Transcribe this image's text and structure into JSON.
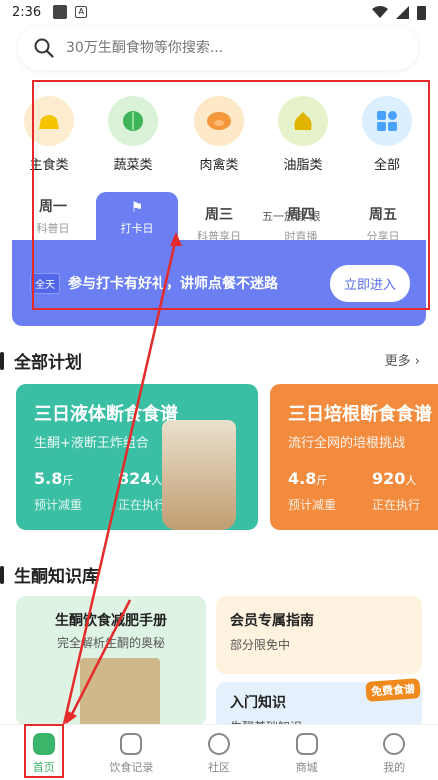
{
  "status": {
    "time": "2:36"
  },
  "search": {
    "placeholder": "30万生酮食物等你搜索..."
  },
  "categories": [
    {
      "label": "主食类",
      "icon": "bread-icon",
      "bg": "#fdeccf"
    },
    {
      "label": "蔬菜类",
      "icon": "vegetable-icon",
      "bg": "#d9f2d8"
    },
    {
      "label": "肉禽类",
      "icon": "pig-icon",
      "bg": "#fde8c7"
    },
    {
      "label": "油脂类",
      "icon": "oil-icon",
      "bg": "#e6f2c9"
    },
    {
      "label": "全部",
      "icon": "grid-icon",
      "bg": "#dbefff"
    }
  ],
  "days": [
    {
      "t": "周一",
      "s": "科普日"
    },
    {
      "t": "",
      "s": "打卡日"
    },
    {
      "t": "周三",
      "s": "科普享日"
    },
    {
      "t": "周四",
      "s": "时直播"
    },
    {
      "t": "周五",
      "s": "分享日"
    }
  ],
  "overlay_day_text": "五一放假 限",
  "banner": {
    "tag": "全天",
    "text": "参与打卡有好礼，讲师点餐不迷路",
    "button": "立即进入"
  },
  "plans_section": {
    "title": "全部计划",
    "more": "更多"
  },
  "plans": [
    {
      "title": "三日液体断食食谱",
      "sub": "生酮+液断王炸组合",
      "n1": "5.8",
      "u1": "斤",
      "c1": "预计减重",
      "n2": "824",
      "u2": "人",
      "c2": "正在执行"
    },
    {
      "title": "三日培根断食食谱",
      "sub": "流行全网的培根挑战",
      "n1": "4.8",
      "u1": "斤",
      "c1": "预计减重",
      "n2": "920",
      "u2": "人",
      "c2": "正在执行"
    }
  ],
  "kb_section": {
    "title": "生酮知识库"
  },
  "kb": {
    "c1_title": "生酮饮食减肥手册",
    "c1_sub": "完全解析生酮的奥秘",
    "c2_title": "会员专属指南",
    "c2_sub": "部分限免中",
    "c3_title": "入门知识",
    "c3_sub": "生酮基础知识",
    "badge": "免费食谱"
  },
  "tabs": [
    {
      "label": "首页",
      "name": "tab-home"
    },
    {
      "label": "饮食记录",
      "name": "tab-diet-record"
    },
    {
      "label": "社区",
      "name": "tab-community"
    },
    {
      "label": "商城",
      "name": "tab-mall"
    },
    {
      "label": "我的",
      "name": "tab-me"
    }
  ]
}
